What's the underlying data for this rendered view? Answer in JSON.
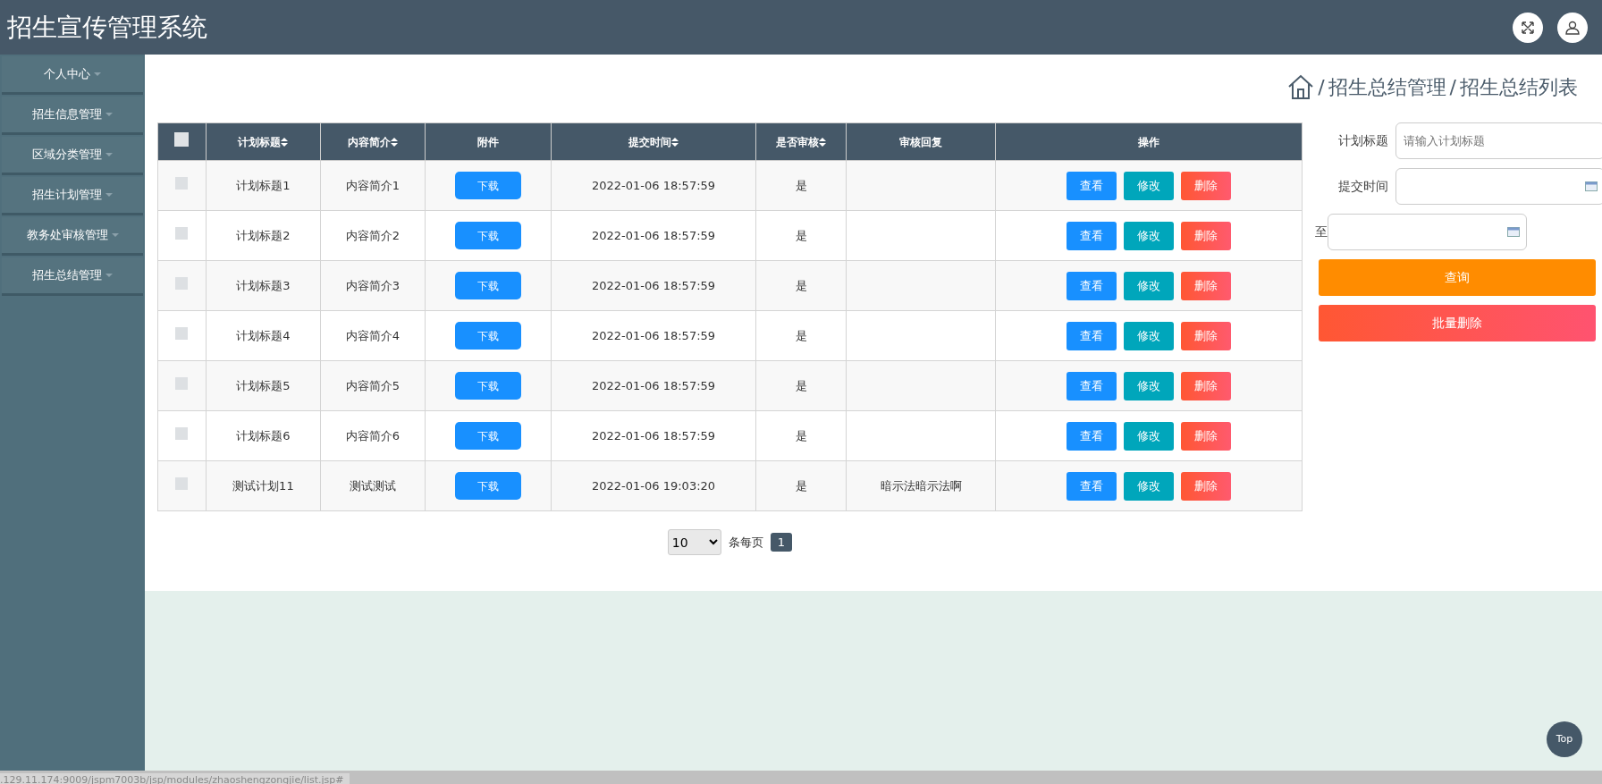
{
  "header": {
    "title": "招生宣传管理系统"
  },
  "sidebar": {
    "items": [
      {
        "label": "个人中心"
      },
      {
        "label": "招生信息管理"
      },
      {
        "label": "区域分类管理"
      },
      {
        "label": "招生计划管理"
      },
      {
        "label": "教务处审核管理"
      },
      {
        "label": "招生总结管理"
      }
    ]
  },
  "breadcrumb": [
    {
      "separator": "/",
      "label": "招生总结管理"
    },
    {
      "separator": "/",
      "label": "招生总结列表"
    }
  ],
  "table": {
    "select_all": {
      "checked": false
    },
    "columns": [
      {
        "label": "计划标题",
        "sortable": true
      },
      {
        "label": "内容简介",
        "sortable": true
      },
      {
        "label": "附件",
        "sortable": false
      },
      {
        "label": "提交时间",
        "sortable": true
      },
      {
        "label": "是否审核",
        "sortable": true
      },
      {
        "label": "审核回复",
        "sortable": false
      },
      {
        "label": "操作",
        "sortable": false
      }
    ],
    "rows": [
      {
        "checked": false,
        "title": "计划标题1",
        "summary": "内容简介1",
        "attachment": "下载",
        "submitted": "2022-01-06 18:57:59",
        "reviewed": "是",
        "actions": [
          {
            "label": "查看",
            "kind": "view"
          },
          {
            "label": "修改",
            "kind": "edit"
          },
          {
            "label": "删除",
            "kind": "delete"
          }
        ]
      },
      {
        "checked": false,
        "title": "计划标题2",
        "summary": "内容简介2",
        "attachment": "下载",
        "submitted": "2022-01-06 18:57:59",
        "reviewed": "是",
        "actions": [
          {
            "label": "查看",
            "kind": "view"
          },
          {
            "label": "修改",
            "kind": "edit"
          },
          {
            "label": "删除",
            "kind": "delete"
          }
        ]
      },
      {
        "checked": false,
        "title": "计划标题3",
        "summary": "内容简介3",
        "attachment": "下载",
        "submitted": "2022-01-06 18:57:59",
        "reviewed": "是",
        "actions": [
          {
            "label": "查看",
            "kind": "view"
          },
          {
            "label": "修改",
            "kind": "edit"
          },
          {
            "label": "删除",
            "kind": "delete"
          }
        ]
      },
      {
        "checked": false,
        "title": "计划标题4",
        "summary": "内容简介4",
        "attachment": "下载",
        "submitted": "2022-01-06 18:57:59",
        "reviewed": "是",
        "actions": [
          {
            "label": "查看",
            "kind": "view"
          },
          {
            "label": "修改",
            "kind": "edit"
          },
          {
            "label": "删除",
            "kind": "delete"
          }
        ]
      },
      {
        "checked": false,
        "title": "计划标题5",
        "summary": "内容简介5",
        "attachment": "下载",
        "submitted": "2022-01-06 18:57:59",
        "reviewed": "是",
        "actions": [
          {
            "label": "查看",
            "kind": "view"
          },
          {
            "label": "修改",
            "kind": "edit"
          },
          {
            "label": "删除",
            "kind": "delete"
          }
        ]
      },
      {
        "checked": false,
        "title": "计划标题6",
        "summary": "内容简介6",
        "attachment": "下载",
        "submitted": "2022-01-06 18:57:59",
        "reviewed": "是",
        "actions": [
          {
            "label": "查看",
            "kind": "view"
          },
          {
            "label": "修改",
            "kind": "edit"
          },
          {
            "label": "删除",
            "kind": "delete"
          }
        ]
      },
      {
        "checked": false,
        "title": "测试计划11",
        "summary": "测试测试",
        "attachment": "下载",
        "submitted": "2022-01-06 19:03:20",
        "reviewed": "是",
        "reply": "暗示法暗示法啊",
        "actions": [
          {
            "label": "查看",
            "kind": "view"
          },
          {
            "label": "修改",
            "kind": "edit"
          },
          {
            "label": "删除",
            "kind": "delete"
          }
        ]
      }
    ]
  },
  "search": {
    "fields": [
      {
        "label": "计划标题",
        "kind": "text",
        "placeholder": "请输入计划标题"
      },
      {
        "label": "提交时间",
        "kind": "date"
      },
      {
        "label": "至",
        "kind": "date"
      }
    ],
    "buttons": [
      {
        "label": "查询",
        "kind": "search"
      },
      {
        "label": "批量删除",
        "kind": "delete"
      }
    ]
  },
  "pagination": {
    "page_size": "10",
    "page_size_label": "条每页",
    "pages": [
      {
        "label": "1",
        "selected": true
      }
    ]
  },
  "top_button": "Top",
  "status_bar": ".129.11.174:9009/jspm7003b/jsp/modules/zhaoshengzongjie/list.jsp#"
}
